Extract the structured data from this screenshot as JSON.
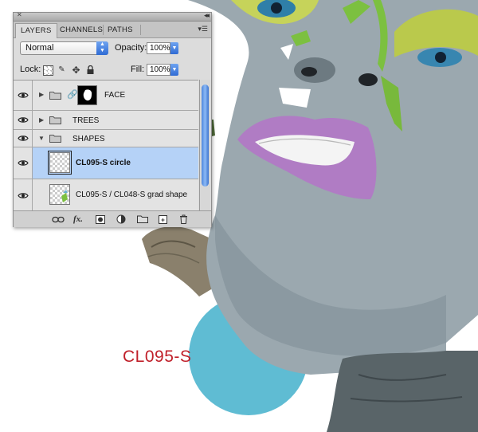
{
  "panel": {
    "tabs": [
      "LAYERS",
      "CHANNELS",
      "PATHS"
    ],
    "blend_mode": "Normal",
    "opacity_label": "Opacity:",
    "opacity_value": "100%",
    "lock_label": "Lock:",
    "fill_label": "Fill:",
    "fill_value": "100%",
    "layers": [
      {
        "name": "FACE",
        "type": "group-with-mask",
        "expanded": false
      },
      {
        "name": "TREES",
        "type": "group",
        "expanded": false
      },
      {
        "name": "SHAPES",
        "type": "group",
        "expanded": true
      },
      {
        "name": "CL095-S circle",
        "type": "layer",
        "selected": true
      },
      {
        "name": "CL095-S / CL048-S grad shape",
        "type": "layer",
        "selected": false
      }
    ],
    "footer_icons": [
      "link-icon",
      "fx-icon",
      "mask-icon",
      "adjustment-icon",
      "new-group-icon",
      "new-layer-icon",
      "trash-icon"
    ]
  },
  "canvas": {
    "caption": "CL095-S",
    "colors": {
      "caption": "#c0202a",
      "circle": "#5fbcd3",
      "lip": "#b07cc4",
      "skin": "#9aa7ae",
      "eyeshadow": "#b8c84a",
      "leaf": "#7cc040"
    }
  },
  "colors": {
    "selection": "#b5d2f7",
    "panel_bg": "#dcdcdc",
    "accent_blue": "#3d7be0"
  }
}
